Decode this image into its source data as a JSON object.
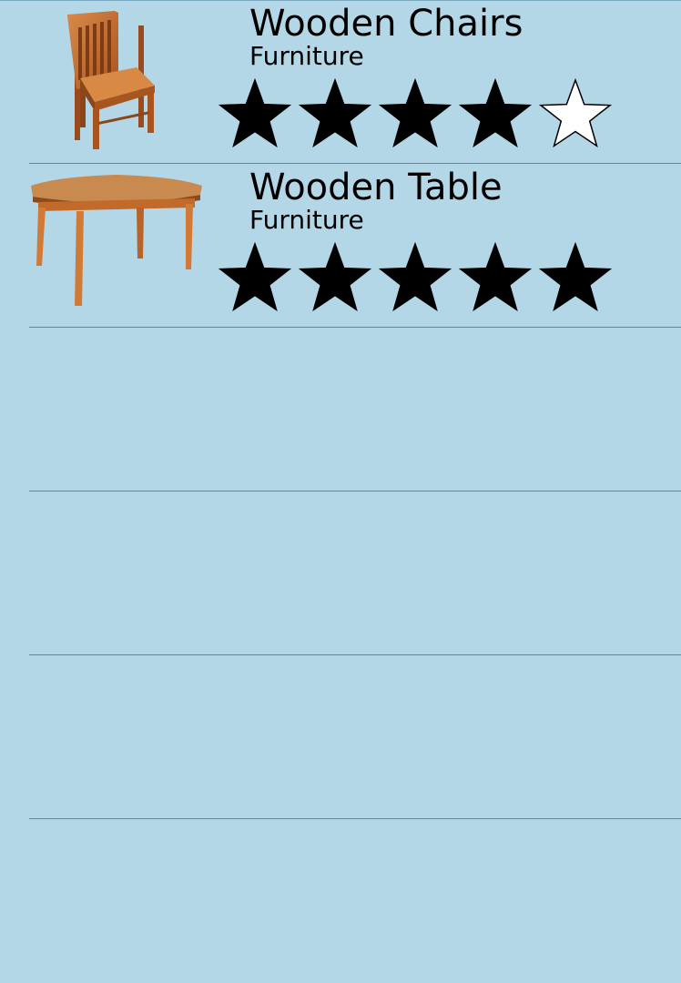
{
  "list": {
    "items": [
      {
        "title": "Wooden Chairs",
        "category": "Furniture",
        "image_icon": "wooden-chair",
        "rating": 4,
        "max_rating": 5
      },
      {
        "title": "Wooden Table",
        "category": "Furniture",
        "image_icon": "wooden-table",
        "rating": 5,
        "max_rating": 5
      }
    ],
    "empty_rows": 4
  },
  "colors": {
    "background": "#b3d7e6",
    "separator": "#3a93c4",
    "star_filled": "#000000",
    "star_empty": "#ffffff",
    "wood": "#c8743a"
  }
}
